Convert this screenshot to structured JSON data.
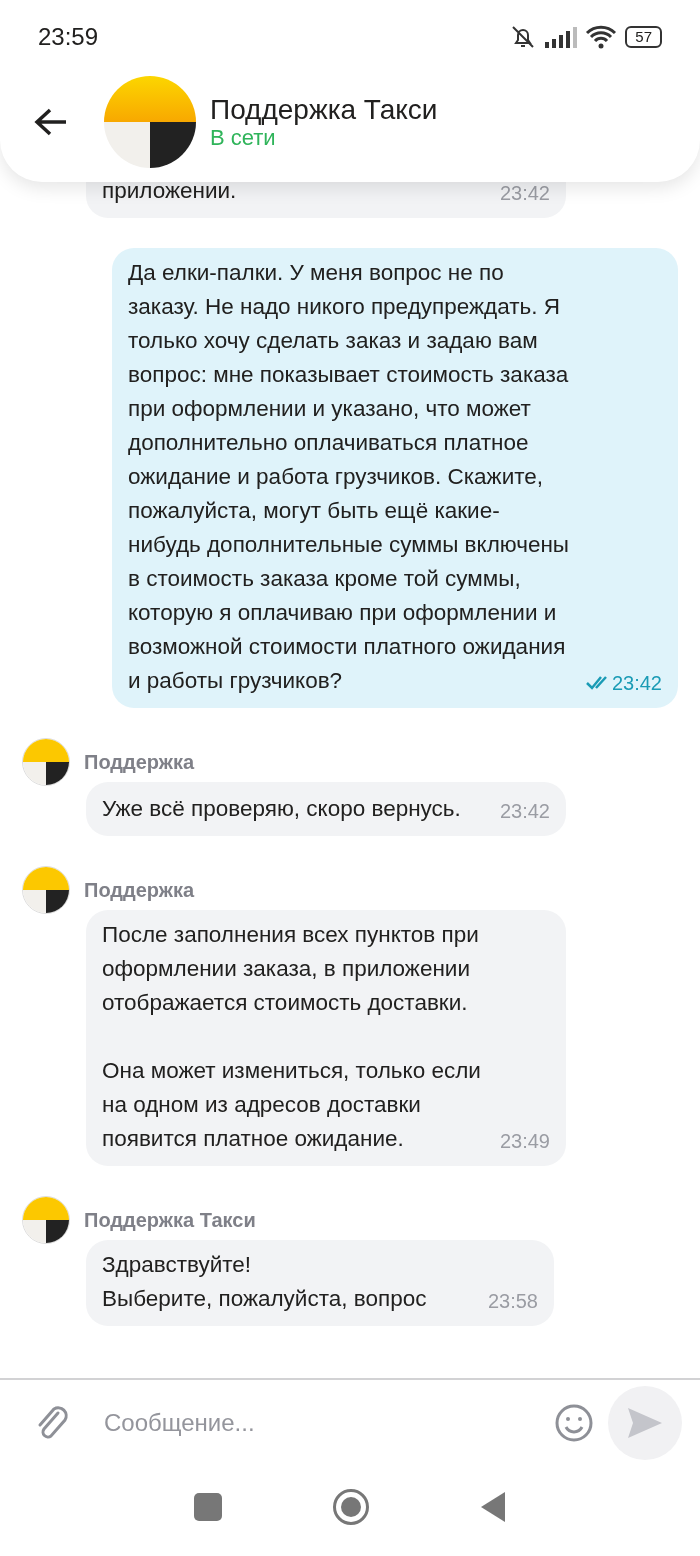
{
  "status_bar": {
    "time": "23:59",
    "battery": "57"
  },
  "header": {
    "title": "Поддержка Такси",
    "status": "В сети"
  },
  "messages": [
    {
      "kind": "incoming",
      "text": "приложении.",
      "time": "23:42",
      "cut": true
    },
    {
      "kind": "outgoing",
      "text": "Да елки-палки. У меня вопрос не по заказу. Не надо никого предупреждать. Я только хочу сделать заказ и задаю вам вопрос: мне показывает стоимость заказа при оформлении и указано, что может дополнительно оплачиваться платное ожидание и работа грузчиков. Скажите, пожалуйста, могут быть ещё какие-нибудь дополнительные суммы включены в стоимость заказа кроме той суммы, которую я оплачиваю при оформлении и возможной стоимости платного ожидания и работы грузчиков?",
      "time": "23:42",
      "read": true
    },
    {
      "kind": "incoming",
      "sender": "Поддержка",
      "text": "Уже всё проверяю, скоро вернусь.",
      "time": "23:42"
    },
    {
      "kind": "incoming",
      "sender": "Поддержка",
      "text": "После заполнения всех пунктов при оформлении заказа, в приложении отображается стоимость доставки.\n\nОна может измениться, только если на одном из адресов доставки появится платное ожидание.",
      "time": "23:49"
    },
    {
      "kind": "incoming",
      "sender": "Поддержка Такси",
      "text": "Здравствуйте!\nВыберите, пожалуйста, вопрос",
      "time": "23:58"
    }
  ],
  "composer": {
    "placeholder": "Сообщение..."
  }
}
